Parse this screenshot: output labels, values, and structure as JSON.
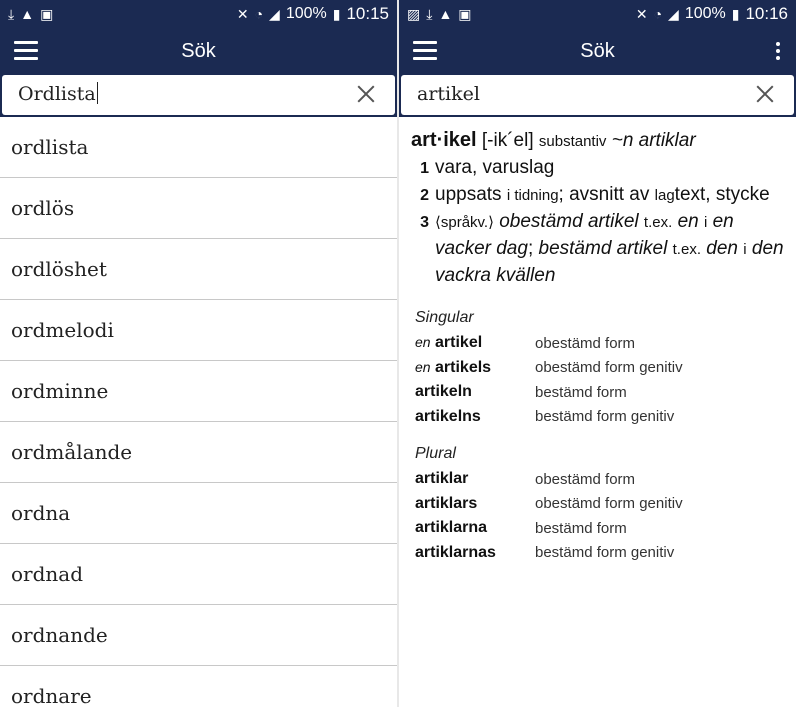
{
  "left": {
    "status": {
      "battery": "100%",
      "time": "10:15"
    },
    "title": "Sök",
    "search_value": "Ordlista",
    "results": [
      "ordlista",
      "ordlös",
      "ordlöshet",
      "ordmelodi",
      "ordminne",
      "ordmålande",
      "ordna",
      "ordnad",
      "ordnande",
      "ordnare"
    ]
  },
  "right": {
    "status": {
      "battery": "100%",
      "time": "10:16"
    },
    "title": "Sök",
    "search_value": "artikel",
    "entry": {
      "headword": "art·ikel",
      "pronunciation": "[-ik´el]",
      "pos": "substantiv",
      "plural_marker": "~n artiklar",
      "senses": [
        {
          "num": "1",
          "text": "vara, varuslag"
        },
        {
          "num": "2",
          "text_a": "uppsats",
          "note": "i tidning",
          "text_b": "; avsnitt av",
          "prefix": "lag",
          "text_c": "text, stycke"
        },
        {
          "num": "3",
          "field": "⟨språkv.⟩",
          "term_a": "obestämd artikel",
          "tex_a": "t.ex.",
          "ex_a1": "en",
          "mid_a": "i",
          "ex_a2": "en vacker dag",
          "semi": ";",
          "term_b": "bestämd artikel",
          "tex_b": "t.ex.",
          "ex_b1": "den",
          "mid_b": "i",
          "ex_b2": "den vackra kvällen"
        }
      ],
      "inflections": {
        "singular_label": "Singular",
        "singular": [
          {
            "article": "en",
            "word": "artikel",
            "form": "obestämd form"
          },
          {
            "article": "en",
            "word": "artikels",
            "form": "obestämd form genitiv"
          },
          {
            "article": "",
            "word": "artikeln",
            "form": "bestämd form"
          },
          {
            "article": "",
            "word": "artikelns",
            "form": "bestämd form genitiv"
          }
        ],
        "plural_label": "Plural",
        "plural": [
          {
            "word": "artiklar",
            "form": "obestämd form"
          },
          {
            "word": "artiklars",
            "form": "obestämd form genitiv"
          },
          {
            "word": "artiklarna",
            "form": "bestämd form"
          },
          {
            "word": "artiklarnas",
            "form": "bestämd form genitiv"
          }
        ]
      }
    }
  },
  "icons": {
    "status_left": [
      "download-icon",
      "warning-icon",
      "bag-icon"
    ],
    "status_right": [
      "mute-icon",
      "wifi-icon",
      "signal-icon",
      "battery-icon"
    ]
  },
  "colors": {
    "appbar": "#1b2a52",
    "divider": "#c8c8c8"
  }
}
